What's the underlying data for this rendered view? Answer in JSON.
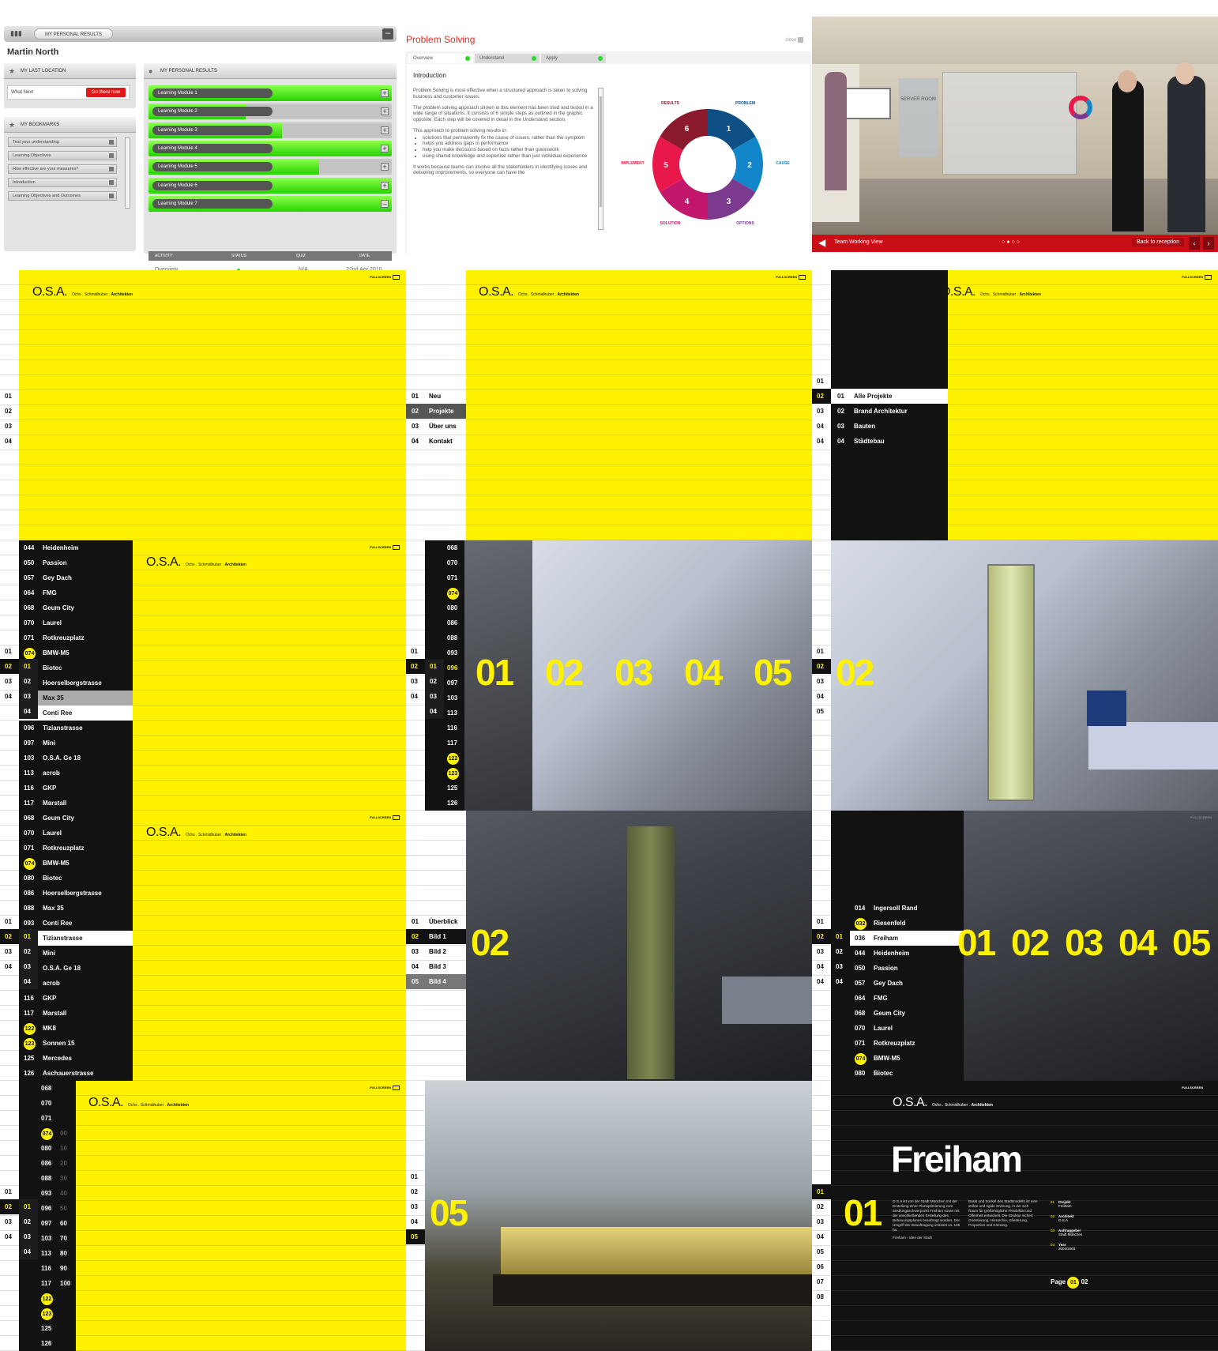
{
  "lms": {
    "header_tab": "MY PERSONAL RESULTS",
    "user": "Martin North",
    "last_location_title": "MY LAST LOCATION",
    "last_location_item": "What Next",
    "go_button": "Go there now",
    "bookmarks_title": "MY BOOKMARKS",
    "bookmarks": [
      "Test your understanding",
      "Learning Objectives",
      "How effective are your measures?",
      "Introduction",
      "Learning Objectives and Outcomes"
    ],
    "results_title": "MY PERSONAL RESULTS",
    "modules": [
      {
        "label": "Learning Module 1",
        "progress": 1
      },
      {
        "label": "Learning Module 2",
        "progress": 0.4
      },
      {
        "label": "Learning Module 3",
        "progress": 0.55
      },
      {
        "label": "Learning Module 4",
        "progress": 1
      },
      {
        "label": "Learning Module 5",
        "progress": 0.7
      },
      {
        "label": "Learning Module 6",
        "progress": 1
      },
      {
        "label": "Learning Module 7",
        "progress": 1
      }
    ],
    "table_headers": [
      "ACTIVITY",
      "STATUS",
      "QUIZ",
      "DATE"
    ],
    "table_row": {
      "activity": "Overview",
      "quiz": "N/A",
      "date": "22nd Apr 2010"
    }
  },
  "problem": {
    "title": "Problem Solving",
    "close": "close",
    "tabs": [
      "Overview",
      "Understand",
      "Apply"
    ],
    "intro_title": "Introduction",
    "p1": "Problem Solving is most effective when a structured approach is taken to solving business and customer issues.",
    "p2": "The problem solving approach shown in this element has been tried and tested in a wide range of situations.  It consists of 6 simple steps as outlined in the graphic opposite. Each step will be covered in detail in the Understand section.",
    "p3": "This approach to problem solving results in:",
    "bullets": [
      "solutions that permanently fix the cause of issues, rather than the symptom",
      "helps you address gaps in performance",
      "help you make decisions based on facts rather than guesswork",
      "using shared knowledge and expertise rather than just individual experience"
    ],
    "p4": "It works because teams can involve all the stakeholders in identifying issues and delivering improvements, so everyone can have the",
    "steps": [
      {
        "n": "1",
        "label": "PROBLEM",
        "color": "#0e4f86"
      },
      {
        "n": "2",
        "label": "CAUSE",
        "color": "#1386c9"
      },
      {
        "n": "3",
        "label": "OPTIONS",
        "color": "#7b3a8e"
      },
      {
        "n": "4",
        "label": "SOLUTION",
        "color": "#c2176c"
      },
      {
        "n": "5",
        "label": "IMPLEMENT",
        "color": "#e8194a"
      },
      {
        "n": "6",
        "label": "RESULTS",
        "color": "#8b1a2d"
      }
    ]
  },
  "video": {
    "caption": "Team Working View",
    "back_button": "Back to reception",
    "sign": "SERVER ROOM"
  },
  "osa": {
    "logo": "O.S.A.",
    "sub_plain": "Ochs . Schmidhuber .",
    "sub_bold": "Architekten",
    "fullscreen": "FULLSCREEN",
    "main_nums": [
      "01",
      "02",
      "03",
      "04"
    ],
    "menu": [
      "Neu",
      "Projekte",
      "Über uns",
      "Kontakt"
    ],
    "submenu": [
      "Alle Projekte",
      "Brand Architektur",
      "Bauten",
      "Städtebau"
    ],
    "projects_a": [
      {
        "n": "044",
        "t": "Heidenheim"
      },
      {
        "n": "050",
        "t": "Passion"
      },
      {
        "n": "057",
        "t": "Gey Dach"
      },
      {
        "n": "064",
        "t": "FMG"
      },
      {
        "n": "068",
        "t": "Geum City"
      },
      {
        "n": "070",
        "t": "Laurel"
      },
      {
        "n": "071",
        "t": "Rotkreuzplatz"
      },
      {
        "n": "074",
        "t": "BMW-M5"
      },
      {
        "n": "080",
        "t": "Biotec"
      },
      {
        "n": "086",
        "t": "Hoerselbergstrasse"
      },
      {
        "n": "088",
        "t": "Max 35"
      },
      {
        "n": "093",
        "t": "Conti Ree"
      },
      {
        "n": "096",
        "t": "Tizianstrasse"
      },
      {
        "n": "097",
        "t": "Mini"
      },
      {
        "n": "103",
        "t": "O.S.A. Ge 18"
      },
      {
        "n": "113",
        "t": "acrob"
      },
      {
        "n": "116",
        "t": "GKP"
      },
      {
        "n": "117",
        "t": "Marstall"
      }
    ],
    "projects_b": [
      {
        "n": "068",
        "t": "Geum City"
      },
      {
        "n": "070",
        "t": "Laurel"
      },
      {
        "n": "071",
        "t": "Rotkreuzplatz"
      },
      {
        "n": "074",
        "t": "BMW-M5"
      },
      {
        "n": "080",
        "t": "Biotec"
      },
      {
        "n": "086",
        "t": "Hoerselbergstrasse"
      },
      {
        "n": "088",
        "t": "Max 35"
      },
      {
        "n": "093",
        "t": "Conti Ree"
      },
      {
        "n": "096",
        "t": "Tizianstrasse"
      },
      {
        "n": "097",
        "t": "Mini"
      },
      {
        "n": "103",
        "t": "O.S.A. Ge 18"
      },
      {
        "n": "113",
        "t": "acrob"
      },
      {
        "n": "116",
        "t": "GKP"
      },
      {
        "n": "117",
        "t": "Marstall"
      },
      {
        "n": "122",
        "t": "MK8"
      },
      {
        "n": "123",
        "t": "Sonnen 15"
      },
      {
        "n": "125",
        "t": "Mercedes"
      },
      {
        "n": "126",
        "t": "Aschauerstrasse"
      }
    ],
    "projects_c": [
      {
        "n": "014",
        "t": "Ingersoll Rand"
      },
      {
        "n": "032",
        "t": "Riesenfeld"
      },
      {
        "n": "036",
        "t": "Freiham"
      },
      {
        "n": "044",
        "t": "Heidenheim"
      },
      {
        "n": "050",
        "t": "Passion"
      },
      {
        "n": "057",
        "t": "Gey Dach"
      },
      {
        "n": "064",
        "t": "FMG"
      },
      {
        "n": "068",
        "t": "Geum City"
      },
      {
        "n": "070",
        "t": "Laurel"
      },
      {
        "n": "071",
        "t": "Rotkreuzplatz"
      },
      {
        "n": "074",
        "t": "BMW-M5"
      },
      {
        "n": "080",
        "t": "Biotec"
      }
    ],
    "numcol": [
      "068",
      "070",
      "071",
      "074",
      "080",
      "086",
      "088",
      "093",
      "096",
      "097",
      "103",
      "113",
      "116",
      "117",
      "122",
      "123",
      "125",
      "126"
    ],
    "numcol_grey": [
      "",
      "",
      "",
      "00",
      "10",
      "20",
      "30",
      "40",
      "50",
      "60",
      "70",
      "80",
      "90",
      "100",
      "",
      "",
      "",
      ""
    ],
    "bild": [
      "Überblick",
      "Bild 1",
      "Bild 2",
      "Bild 3",
      "Bild 4"
    ],
    "big_nums": [
      "01",
      "02",
      "03",
      "04",
      "05"
    ],
    "single_02": "02",
    "single_05": "05",
    "freiham_title": "Freiham",
    "freiham_num": "01",
    "freiham_nums": [
      "01",
      "02",
      "03",
      "04",
      "05",
      "06",
      "07",
      "08"
    ],
    "freiham_text1": "O.S.A ist von der Stadt München mit der Erstellung einer Planoptimierung zum Siedlungsschwerpunkt Freiham sowie mit der anschließenden Erstellung des Bebauungsplanes beauftragt worden. Der Umgriff der Beauftragung umfasst ca. 165 ha.",
    "freiham_text1b": "Freiham - Idee der Stadt",
    "freiham_text2": "Basis und Sockel des Stadtmodells ist eine strikte und rigide Ordnung, in der sich Raum für größtmögliche Flexibilität und Offenheit entwickelt. Die Struktur sichert Orientierung, Hierarchie, Gliederung, Proportion und Körnung.",
    "freiham_info": [
      {
        "n": "01",
        "k": "Projekt",
        "v": "Freiham"
      },
      {
        "n": "02",
        "k": "Architekt",
        "v": "O.S.A"
      },
      {
        "n": "03",
        "k": "Auftraggeber",
        "v": "Stadt München"
      },
      {
        "n": "04",
        "k": "Year",
        "v": "2002/2003"
      }
    ],
    "page_label": "Page",
    "page_current": "01",
    "page_next": "02"
  }
}
